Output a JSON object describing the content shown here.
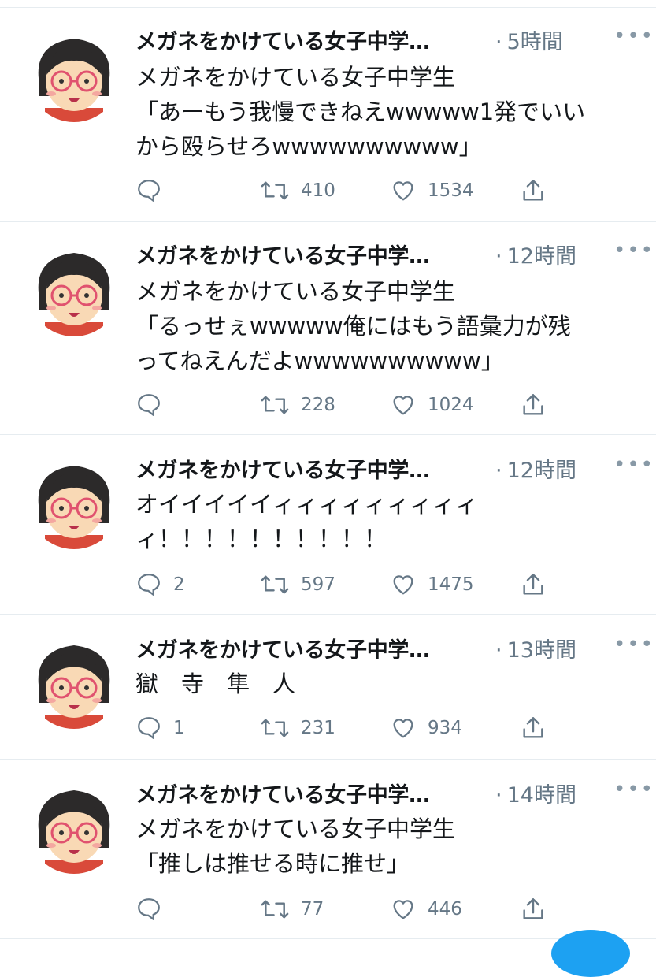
{
  "tweets": [
    {
      "name": "メガネをかけている女子中学…",
      "time": "5時間",
      "text": "メガネをかけている女子中学生\n「あーもう我慢できねえwwwww1発でいい\nから殴らせろwwwwwwwwww」",
      "reply_count": "",
      "retweet_count": "410",
      "like_count": "1534"
    },
    {
      "name": "メガネをかけている女子中学…",
      "time": "12時間",
      "text": "メガネをかけている女子中学生\n「るっせぇwwwww俺にはもう語彙力が残\nってねえんだよwwwwwwwwww」",
      "reply_count": "",
      "retweet_count": "228",
      "like_count": "1024"
    },
    {
      "name": "メガネをかけている女子中学…",
      "time": "12時間",
      "text": "オイイイイイィィィィィィィィィ\nィ！！！！！！！！！！",
      "reply_count": "2",
      "retweet_count": "597",
      "like_count": "1475"
    },
    {
      "name": "メガネをかけている女子中学…",
      "time": "13時間",
      "text": "獄　寺　隼　人",
      "reply_count": "1",
      "retweet_count": "231",
      "like_count": "934"
    },
    {
      "name": "メガネをかけている女子中学…",
      "time": "14時間",
      "text": "メガネをかけている女子中学生\n「推しは推せる時に推せ」",
      "reply_count": "",
      "retweet_count": "77",
      "like_count": "446"
    }
  ],
  "icons": {
    "reply": "reply-icon",
    "retweet": "retweet-icon",
    "like": "like-icon",
    "share": "share-icon",
    "more": "more-icon"
  },
  "colors": {
    "text": "#14171a",
    "secondary": "#657786",
    "divider": "#e6ecf0",
    "accent": "#1da1f2"
  }
}
